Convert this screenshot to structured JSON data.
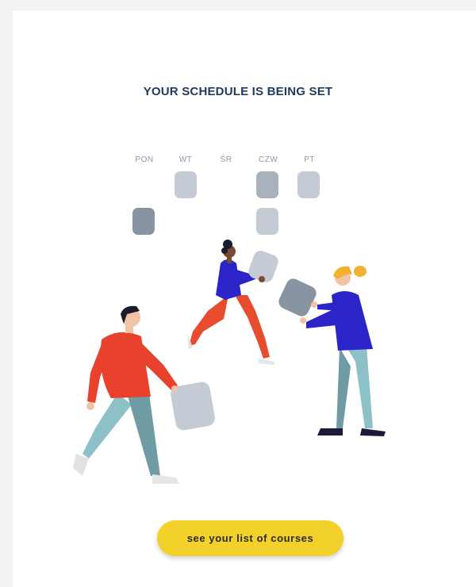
{
  "header": {
    "title": "YOUR SCHEDULE IS BEING SET"
  },
  "schedule": {
    "days": [
      "PON",
      "WT",
      "ŚR",
      "CZW",
      "PT"
    ]
  },
  "actions": {
    "cta_label": "see your list of courses"
  },
  "colors": {
    "accent_yellow": "#f2d22a",
    "title_navy": "#1f3a5c",
    "block_light": "#c4cbd4",
    "block_dark": "#8894a2"
  },
  "icons": [
    "schedule-illustration"
  ]
}
